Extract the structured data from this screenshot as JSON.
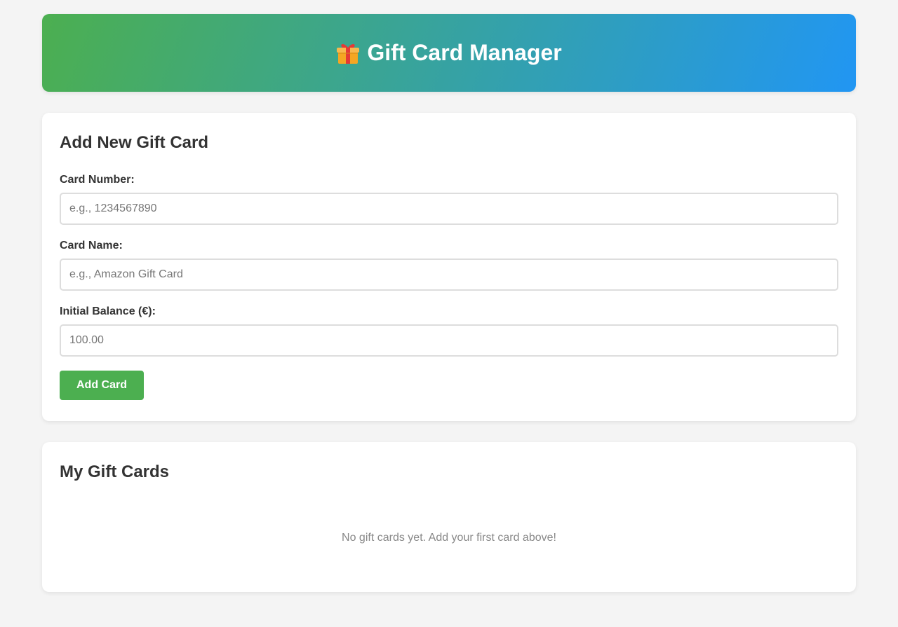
{
  "header": {
    "title": "Gift Card Manager",
    "icon": "gift-icon"
  },
  "add_form": {
    "heading": "Add New Gift Card",
    "card_number": {
      "label": "Card Number:",
      "placeholder": "e.g., 1234567890",
      "value": ""
    },
    "card_name": {
      "label": "Card Name:",
      "placeholder": "e.g., Amazon Gift Card",
      "value": ""
    },
    "initial_balance": {
      "label": "Initial Balance (€):",
      "placeholder": "100.00",
      "value": ""
    },
    "submit_label": "Add Card"
  },
  "card_list": {
    "heading": "My Gift Cards",
    "empty_message": "No gift cards yet. Add your first card above!"
  },
  "colors": {
    "accent_green": "#4caf50",
    "accent_blue": "#2196f3",
    "background": "#f4f4f4"
  }
}
